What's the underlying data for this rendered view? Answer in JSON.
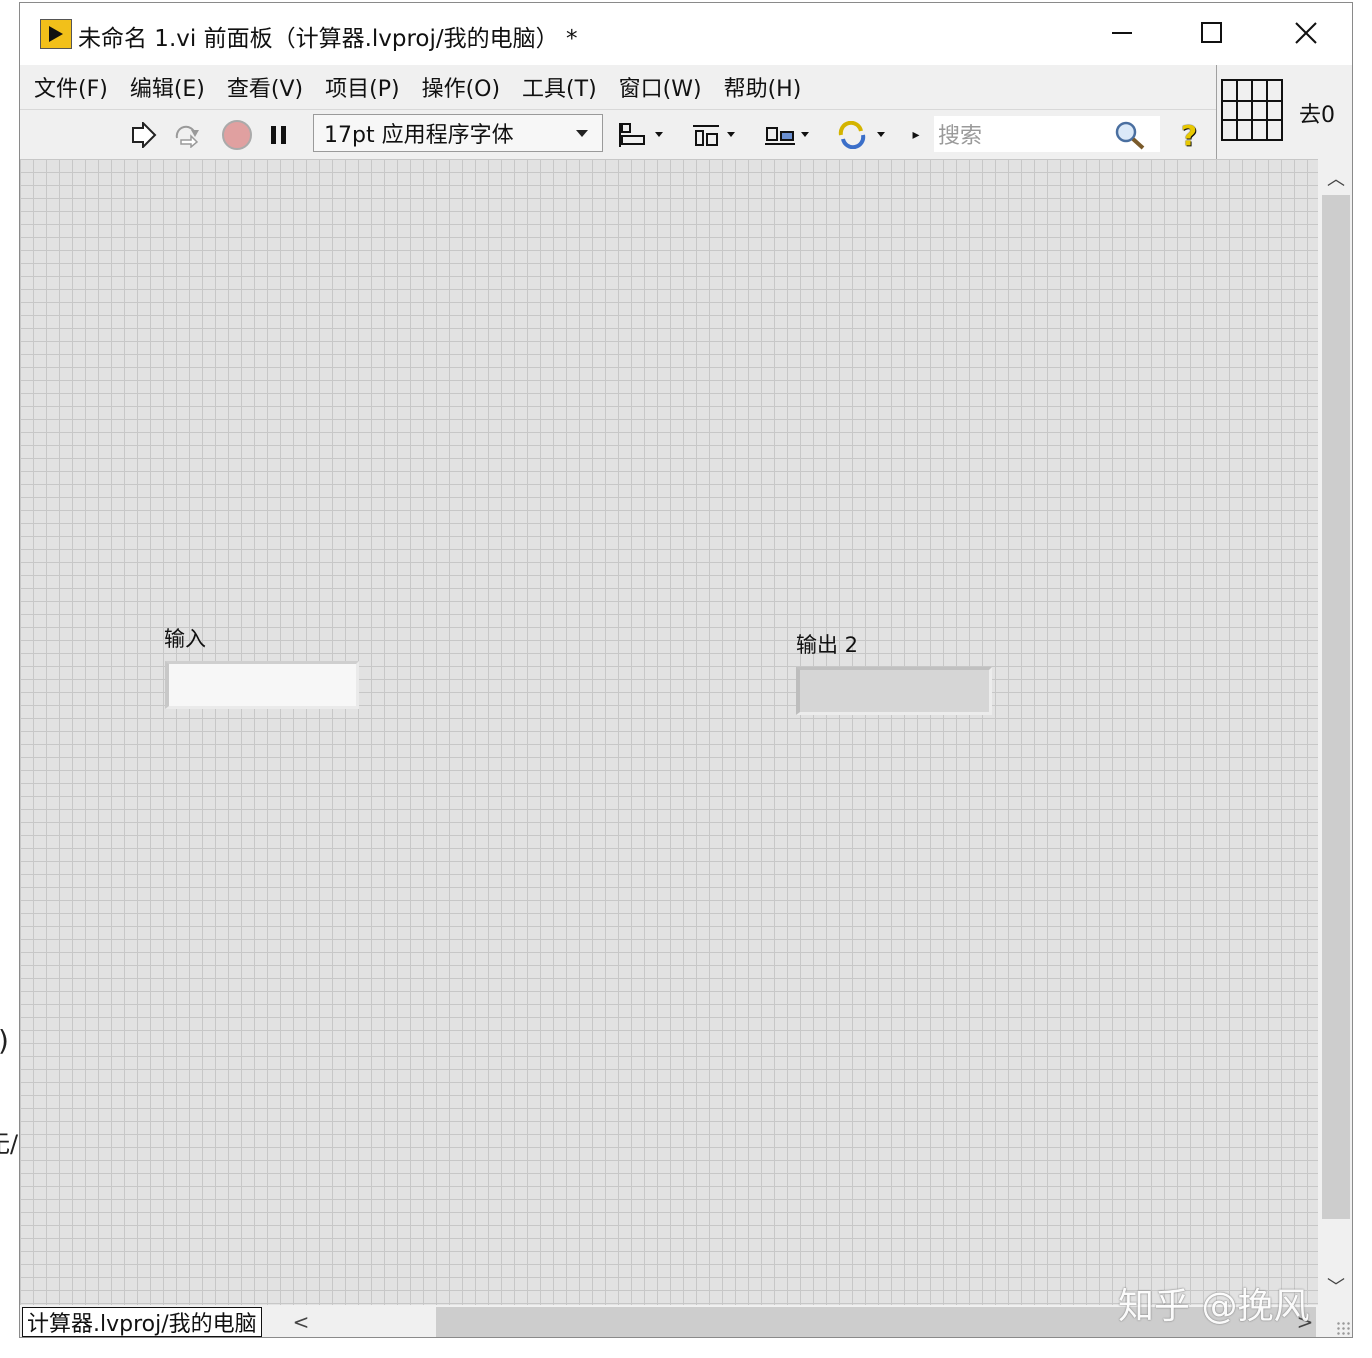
{
  "window": {
    "title": "未命名 1.vi 前面板（计算器.lvproj/我的电脑） *",
    "controls": {
      "minimize": "—",
      "maximize": "☐",
      "close": "✕"
    }
  },
  "menubar": {
    "items": [
      "文件(F)",
      "编辑(E)",
      "查看(V)",
      "项目(P)",
      "操作(O)",
      "工具(T)",
      "窗口(W)",
      "帮助(H)"
    ]
  },
  "toolbar": {
    "icons": [
      "run-arrow-icon",
      "run-continuously-icon",
      "abort-icon",
      "pause-icon"
    ],
    "font_selector": "17pt 应用程序字体",
    "align_icons": [
      "align-objects-icon",
      "distribute-objects-icon",
      "resize-objects-icon",
      "reorder-icon"
    ],
    "search_placeholder": "搜索",
    "help_label": "?"
  },
  "connector_pane": {
    "icon_label": "去0"
  },
  "front_panel": {
    "controls": [
      {
        "label": "输入",
        "type": "numeric-control",
        "value": ""
      },
      {
        "label": "输出 2",
        "type": "numeric-indicator",
        "value": ""
      }
    ]
  },
  "statusbar": {
    "context": "计算器.lvproj/我的电脑",
    "scroll_left": "<",
    "scroll_right": ">"
  },
  "watermark": "知乎 @挽风",
  "background": {
    "glyph_1": ")",
    "glyph_2": "无/"
  },
  "colors": {
    "panel_bg": "#e2e2e2",
    "grid_line": "#c7c7c7",
    "window_chrome": "#f0f0f0",
    "app_icon": "#f2c01a",
    "abort_button": "#e0a0a0"
  }
}
